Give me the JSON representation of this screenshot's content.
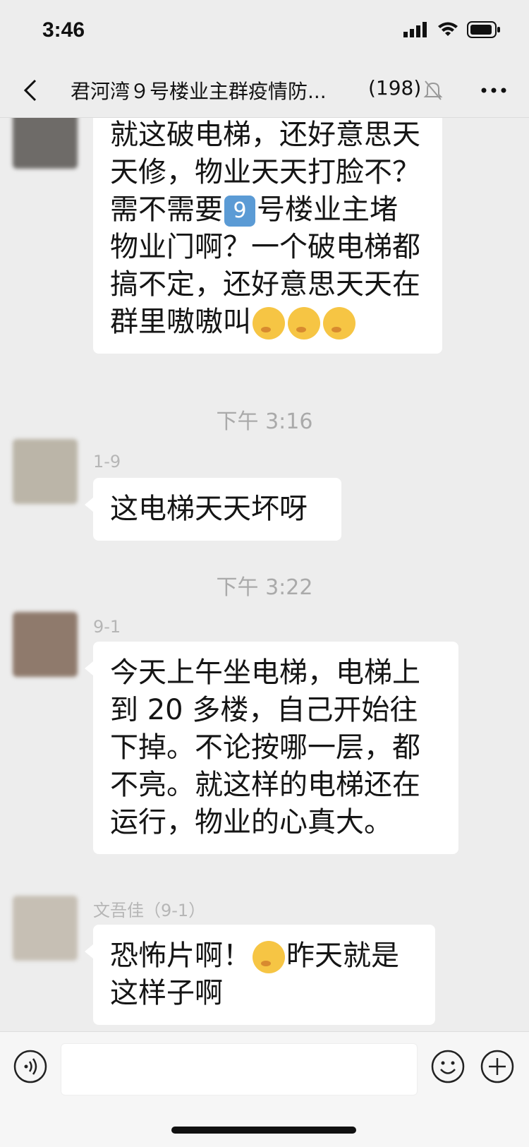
{
  "status": {
    "time": "3:46"
  },
  "header": {
    "title": "君河湾９号楼业主群疫情防...",
    "count": "(198)"
  },
  "messages": [
    {
      "text_a": "就这破电梯，还好意思天天修，物业天天打脸不？需不需要",
      "badge": "9",
      "text_b": "号楼业主堵物业门啊？一个破电梯都搞不定，还好意思天天在群里嗷嗷叫"
    },
    {
      "timestamp": "下午 3:16",
      "sender": "1-9",
      "text": "这电梯天天坏呀"
    },
    {
      "timestamp": "下午 3:22",
      "sender": "9-1",
      "text": "今天上午坐电梯，电梯上到 20 多楼，自己开始往下掉。不论按哪一层，都不亮。就这样的电梯还在运行，物业的心真大。"
    },
    {
      "sender": "文吾佳（9-1）",
      "text_a": "恐怖片啊！",
      "text_b": "昨天就是这样子啊"
    }
  ],
  "icons": [
    "back-icon",
    "mute-icon",
    "more-icon",
    "voice-icon",
    "emoji-icon",
    "plus-icon",
    "signal-icon",
    "wifi-icon",
    "battery-icon"
  ]
}
